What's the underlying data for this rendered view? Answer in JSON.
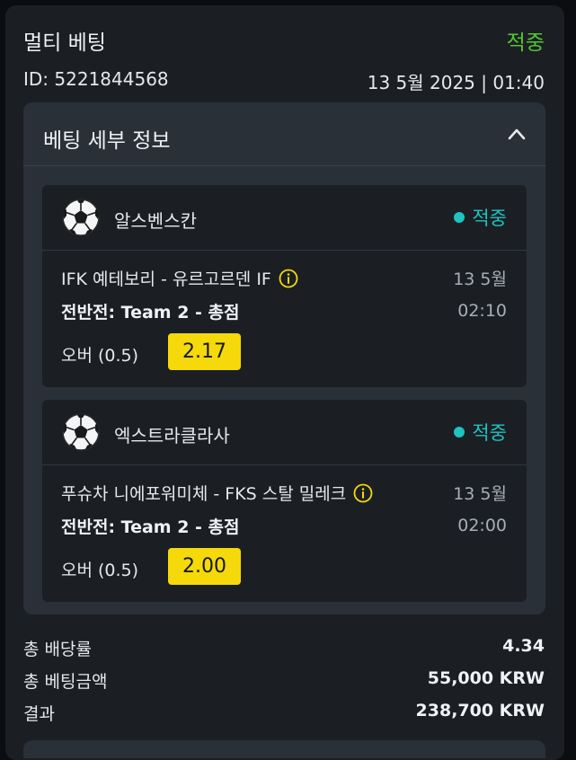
{
  "header": {
    "title": "멀티 베팅",
    "status": "적중",
    "bet_id": "ID: 5221844568",
    "datetime": "13 5월 2025 | 01:40"
  },
  "details": {
    "title": "베팅 세부 정보",
    "expanded": true,
    "toggle_icon": "chevron-up-icon",
    "legs": [
      {
        "sport_icon": "soccer-ball-icon",
        "league": "알스벤스칸",
        "status": "적중",
        "match": "IFK 예테보리 - 유르고르덴 IF",
        "date": "13 5월",
        "time": "02:10",
        "market": "전반전: Team 2 - 총점",
        "selection": "오버 (0.5)",
        "odds": "2.17"
      },
      {
        "sport_icon": "soccer-ball-icon",
        "league": "엑스트라클라사",
        "status": "적중",
        "match": "푸슈차 니에포워미체 - FKS 스탈 밀레크",
        "date": "13 5월",
        "time": "02:00",
        "market": "전반전: Team 2 - 총점",
        "selection": "오버 (0.5)",
        "odds": "2.00"
      }
    ]
  },
  "summary": {
    "total_odds_label": "총 배당률",
    "total_odds_value": "4.34",
    "total_stake_label": "총 베팅금액",
    "total_stake_value": "55,000 KRW",
    "result_label": "결과",
    "result_value": "238,700 KRW"
  },
  "colors": {
    "win_green": "#54c52f",
    "leg_status_teal": "#1fc3c0",
    "odds_yellow": "#f5d90a",
    "card_bg": "#1b1f24",
    "panel_bg": "#2a3038"
  }
}
